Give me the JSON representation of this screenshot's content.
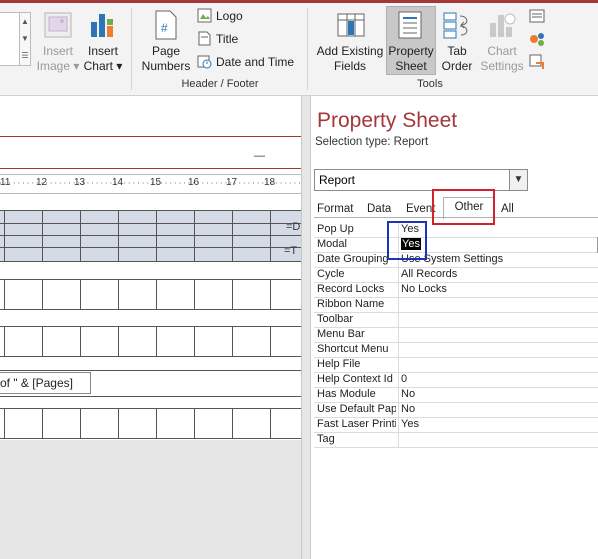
{
  "ribbon": {
    "buttons": {
      "insert_image": {
        "line1": "Insert",
        "line2": "Image ▾"
      },
      "insert_chart": {
        "line1": "Insert",
        "line2": "Chart ▾"
      },
      "page_numbers": {
        "line1": "Page",
        "line2": "Numbers"
      },
      "logo": "Logo",
      "title": "Title",
      "date_and_time": "Date and Time",
      "add_existing_fields": {
        "line1": "Add Existing",
        "line2": "Fields"
      },
      "property_sheet": {
        "line1": "Property",
        "line2": "Sheet"
      },
      "tab_order": {
        "line1": "Tab",
        "line2": "Order"
      },
      "chart_settings": {
        "line1": "Chart",
        "line2": "Settings"
      }
    },
    "groups": {
      "header_footer": "Header / Footer",
      "tools": "Tools"
    }
  },
  "design": {
    "ruler_numbers": [
      "11",
      "12",
      "13",
      "14",
      "15",
      "16",
      "17",
      "18"
    ],
    "band_labels": [
      "=D",
      "=T"
    ],
    "footer_expression": "of \" & [Pages]",
    "dash": "—"
  },
  "property_sheet": {
    "title": "Property Sheet",
    "selection_type_label": "Selection type:",
    "selection_type_value": "Report",
    "selector_value": "Report",
    "tabs": [
      "Format",
      "Data",
      "Event",
      "Other",
      "All"
    ],
    "active_tab": "Other",
    "properties": [
      {
        "name": "Pop Up",
        "value": "Yes"
      },
      {
        "name": "Modal",
        "value": "Yes"
      },
      {
        "name": "Date Grouping",
        "value": "Use System Settings"
      },
      {
        "name": "Cycle",
        "value": "All Records"
      },
      {
        "name": "Record Locks",
        "value": "No Locks"
      },
      {
        "name": "Ribbon Name",
        "value": ""
      },
      {
        "name": "Toolbar",
        "value": ""
      },
      {
        "name": "Menu Bar",
        "value": ""
      },
      {
        "name": "Shortcut Menu",
        "value": ""
      },
      {
        "name": "Help File",
        "value": ""
      },
      {
        "name": "Help Context Id",
        "value": "0"
      },
      {
        "name": "Has Module",
        "value": "No"
      },
      {
        "name": "Use Default Paper Size",
        "value": "No"
      },
      {
        "name": "Fast Laser Printing",
        "value": "Yes"
      },
      {
        "name": "Tag",
        "value": ""
      }
    ]
  },
  "colors": {
    "accent": "#a4373a",
    "highlight_red": "#d1222b",
    "highlight_blue": "#1c33b5",
    "band_fill": "#d5dbe6"
  }
}
